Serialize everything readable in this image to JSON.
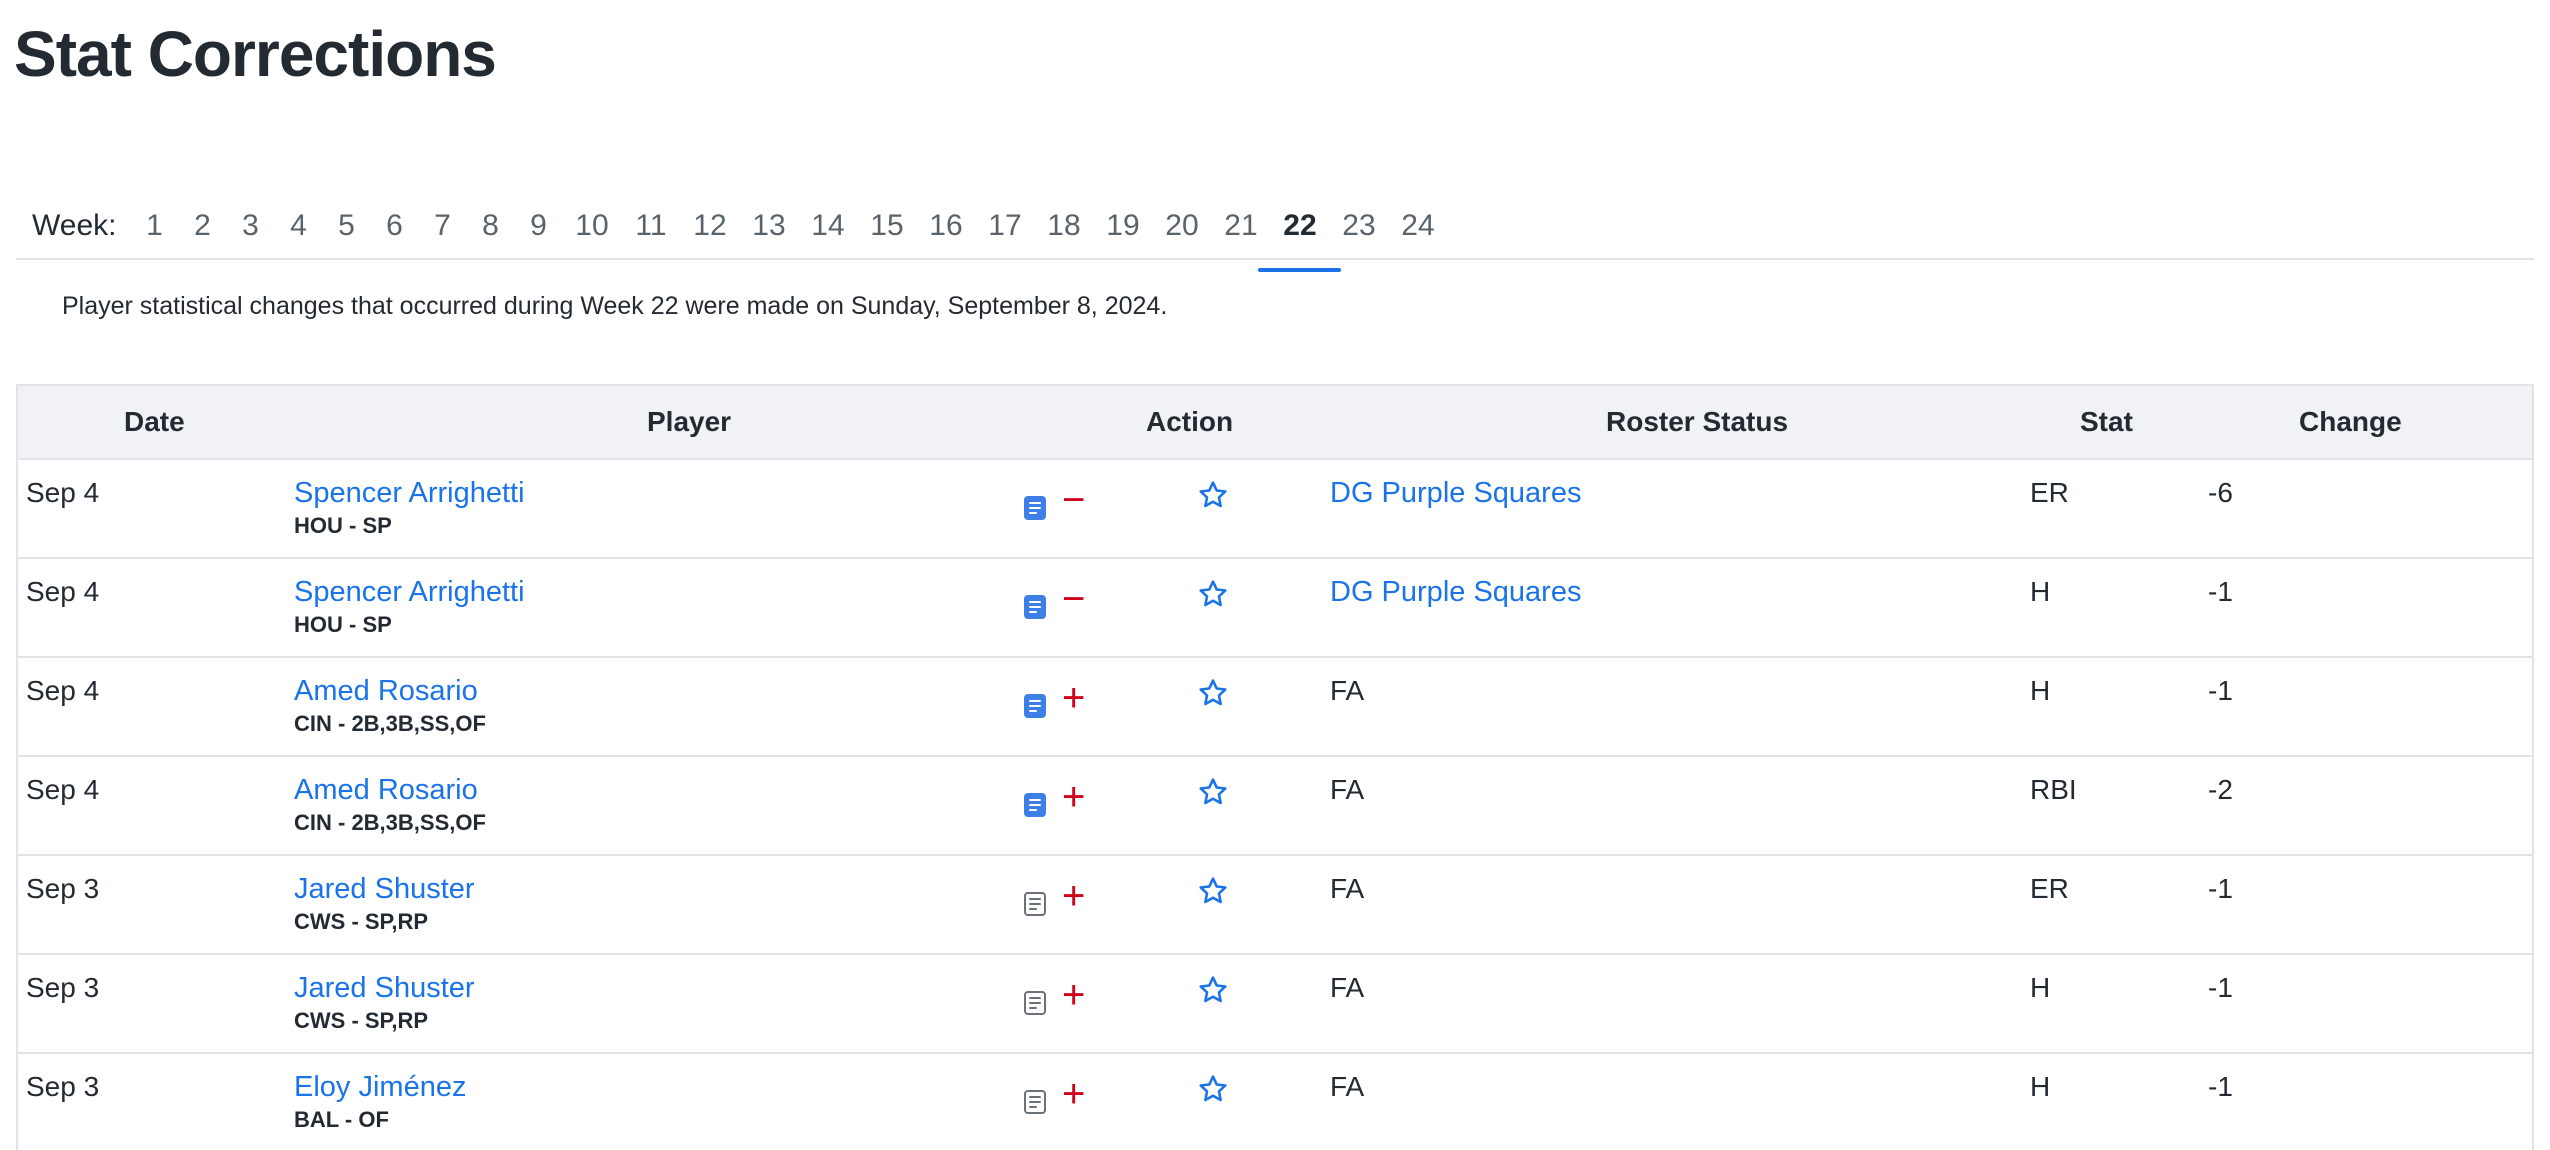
{
  "page": {
    "title": "Stat Corrections"
  },
  "week_nav": {
    "label": "Week:",
    "weeks": [
      "1",
      "2",
      "3",
      "4",
      "5",
      "6",
      "7",
      "8",
      "9",
      "10",
      "11",
      "12",
      "13",
      "14",
      "15",
      "16",
      "17",
      "18",
      "19",
      "20",
      "21",
      "22",
      "23",
      "24"
    ],
    "selected": "22"
  },
  "note": "Player statistical changes that occurred during Week 22 were made on Sunday, September 8, 2024.",
  "table": {
    "headers": {
      "date": "Date",
      "player": "Player",
      "action": "Action",
      "roster_status": "Roster Status",
      "stat": "Stat",
      "change": "Change"
    },
    "rows": [
      {
        "date": "Sep 4",
        "player": "Spencer Arrighetti",
        "meta": "HOU - SP",
        "note_icon": "note-filled-icon",
        "action_icon": "minus-icon",
        "action_symbol": "−",
        "roster": "DG Purple Squares",
        "roster_is_link": true,
        "stat": "ER",
        "change": "-6"
      },
      {
        "date": "Sep 4",
        "player": "Spencer Arrighetti",
        "meta": "HOU - SP",
        "note_icon": "note-filled-icon",
        "action_icon": "minus-icon",
        "action_symbol": "−",
        "roster": "DG Purple Squares",
        "roster_is_link": true,
        "stat": "H",
        "change": "-1"
      },
      {
        "date": "Sep 4",
        "player": "Amed Rosario",
        "meta": "CIN - 2B,3B,SS,OF",
        "note_icon": "note-filled-icon",
        "action_icon": "plus-icon",
        "action_symbol": "+",
        "roster": "FA",
        "roster_is_link": false,
        "stat": "H",
        "change": "-1"
      },
      {
        "date": "Sep 4",
        "player": "Amed Rosario",
        "meta": "CIN - 2B,3B,SS,OF",
        "note_icon": "note-filled-icon",
        "action_icon": "plus-icon",
        "action_symbol": "+",
        "roster": "FA",
        "roster_is_link": false,
        "stat": "RBI",
        "change": "-2"
      },
      {
        "date": "Sep 3",
        "player": "Jared Shuster",
        "meta": "CWS - SP,RP",
        "note_icon": "note-outline-icon",
        "action_icon": "plus-icon",
        "action_symbol": "+",
        "roster": "FA",
        "roster_is_link": false,
        "stat": "ER",
        "change": "-1"
      },
      {
        "date": "Sep 3",
        "player": "Jared Shuster",
        "meta": "CWS - SP,RP",
        "note_icon": "note-outline-icon",
        "action_icon": "plus-icon",
        "action_symbol": "+",
        "roster": "FA",
        "roster_is_link": false,
        "stat": "H",
        "change": "-1"
      },
      {
        "date": "Sep 3",
        "player": "Eloy Jiménez",
        "meta": "BAL - OF",
        "note_icon": "note-outline-icon",
        "action_icon": "plus-icon",
        "action_symbol": "+",
        "roster": "FA",
        "roster_is_link": false,
        "stat": "H",
        "change": "-1"
      }
    ]
  },
  "colors": {
    "link": "#1a73e8",
    "action_red": "#d0021b",
    "header_bg": "#f0f2f5",
    "active_tab_underline": "#1a73e8"
  }
}
